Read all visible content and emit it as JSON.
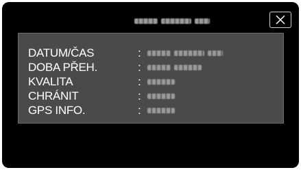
{
  "header": {
    "title_obscured": true,
    "close_label": "close"
  },
  "info": {
    "rows": [
      {
        "label": "DATUM/ČAS",
        "colon": ":",
        "value_obscured": true
      },
      {
        "label": "DOBA PŘEH.",
        "colon": ":",
        "value_obscured": true
      },
      {
        "label": "KVALITA",
        "colon": ":",
        "value_obscured": true
      },
      {
        "label": "CHRÁNIT",
        "colon": ":",
        "value_obscured": true
      },
      {
        "label": "GPS INFO.",
        "colon": ":",
        "value_obscured": true
      }
    ]
  },
  "colors": {
    "screen_bg": "#000000",
    "panel_bg": "#4a4a4a",
    "text": "#ffffff"
  },
  "icons": {
    "close": "close-icon"
  }
}
